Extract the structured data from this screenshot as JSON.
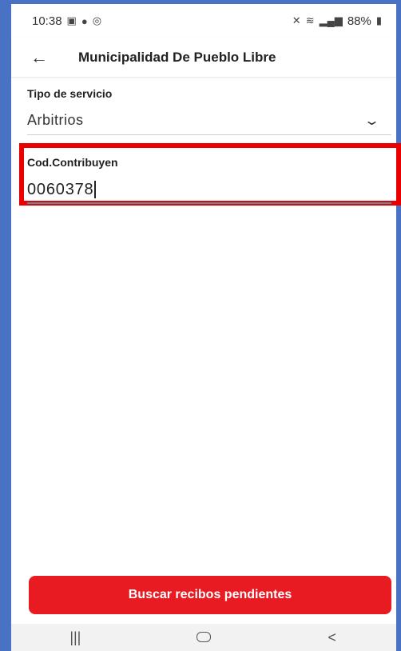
{
  "status_bar": {
    "time": "10:38",
    "battery": "88%"
  },
  "app_bar": {
    "back_icon": "arrow-left-icon",
    "title": "Municipalidad De Pueblo Libre"
  },
  "form": {
    "service_type": {
      "label": "Tipo de servicio",
      "value": "Arbitrios",
      "icon": "chevron-down-icon"
    },
    "taxpayer_code": {
      "label": "Cod.Contribuyen",
      "value": "0060378"
    }
  },
  "actions": {
    "search_label": "Buscar recibos pendientes"
  },
  "colors": {
    "primary_button": "#e91b22",
    "highlight": "#ea0000",
    "input_underline": "#3d9aa8",
    "frame": "#4a72c4"
  },
  "nav_bar": {
    "recent_icon": "recent-apps-icon",
    "home_icon": "home-icon",
    "back_icon": "back-icon"
  }
}
